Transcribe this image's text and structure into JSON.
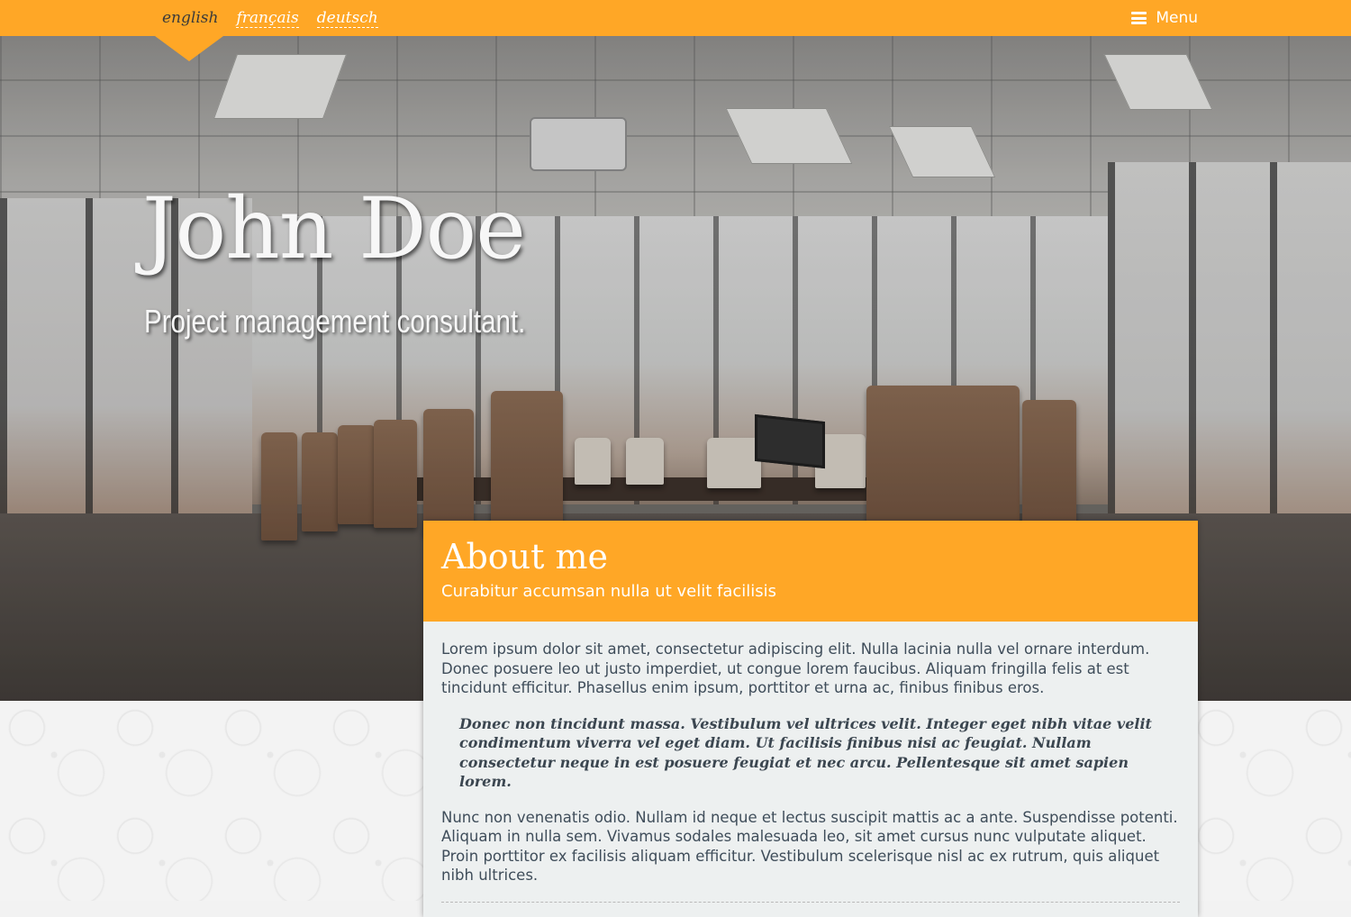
{
  "languages": {
    "items": [
      {
        "label": "english",
        "active": true
      },
      {
        "label": "français",
        "active": false
      },
      {
        "label": "deutsch",
        "active": false
      }
    ]
  },
  "menu": {
    "label": "Menu",
    "icon": "hamburger-icon"
  },
  "hero": {
    "title": "John Doe",
    "subtitle": "Project management consultant."
  },
  "about": {
    "title": "About me",
    "subtitle": "Curabitur accumsan nulla ut velit facilisis",
    "paragraph_1": "Lorem ipsum dolor sit amet, consectetur adipiscing elit. Nulla lacinia nulla vel ornare interdum. Donec posuere leo ut justo imperdiet, ut congue lorem faucibus. Aliquam fringilla felis at est tincidunt efficitur. Phasellus enim ipsum, porttitor et urna ac, finibus finibus eros.",
    "quote": "Donec non tincidunt massa. Vestibulum vel ultrices velit. Integer eget nibh vitae velit condimentum viverra vel eget diam. Ut facilisis finibus nisi ac feugiat. Nullam consectetur neque in est posuere feugiat et nec arcu. Pellentesque sit amet sapien lorem.",
    "paragraph_2": "Nunc non venenatis odio. Nullam id neque et lectus suscipit mattis ac a ante. Suspendisse potenti. Aliquam in nulla sem. Vivamus sodales malesuada leo, sit amet cursus nunc vulputate aliquet. Proin porttitor ex facilisis aliquam efficitur. Vestibulum scelerisque nisl ac ex rutrum, quis aliquet nibh ultrices."
  },
  "colors": {
    "accent": "#ffa726",
    "card_background": "#edf0f0",
    "body_text": "#3f4d5a"
  }
}
